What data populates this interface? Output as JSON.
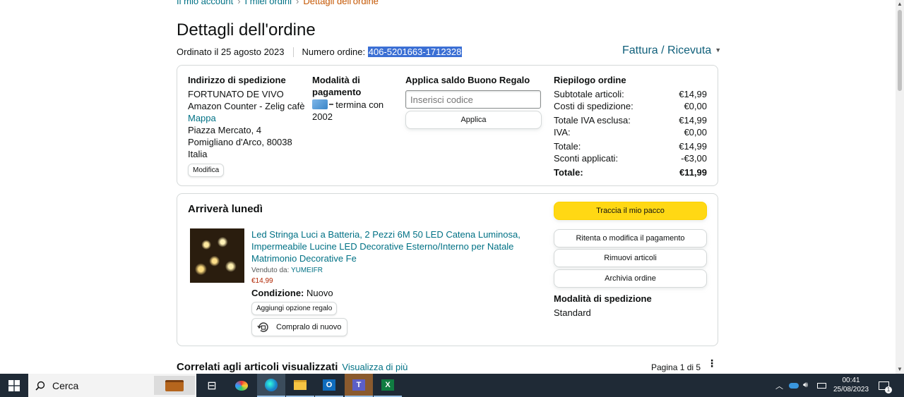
{
  "breadcrumb": {
    "items": [
      "Il mio account",
      "I miei ordini",
      "Dettagli dell'ordine"
    ],
    "separator": "›"
  },
  "title": "Dettagli dell'ordine",
  "order_meta": {
    "ordered_on": "Ordinato il 25 agosto 2023",
    "number_label": "Numero ordine:",
    "number": "406-5201663-1712328"
  },
  "invoice_link": "Fattura / Ricevuta",
  "shipping_address": {
    "heading": "Indirizzo di spedizione",
    "lines": [
      "FORTUNATO DE VIVO",
      "Amazon Counter - Zelig cafè"
    ],
    "map_link": "Mappa",
    "lines2": [
      "Piazza Mercato, 4",
      "Pomigliano d'Arco, 80038",
      "Italia"
    ],
    "edit_button": "Modifica"
  },
  "payment": {
    "heading_line1": "Modalità di",
    "heading_line2": "pagamento",
    "card_text": "termina con",
    "card_digits": "2002"
  },
  "gift": {
    "heading": "Applica saldo Buono Regalo",
    "placeholder": "Inserisci codice",
    "apply_button": "Applica"
  },
  "summary": {
    "heading": "Riepilogo ordine",
    "rows": [
      {
        "label": "Subtotale articoli:",
        "value": "€14,99"
      },
      {
        "label": "Costi di spedizione:",
        "value": "€0,00"
      },
      {
        "label": "Totale IVA esclusa:",
        "value": "€14,99"
      },
      {
        "label": "IVA:",
        "value": "€0,00"
      },
      {
        "label": "Totale:",
        "value": "€14,99"
      },
      {
        "label": "Sconti applicati:",
        "value": "-€3,00"
      }
    ],
    "total": {
      "label": "Totale:",
      "value": "€11,99"
    }
  },
  "shipment": {
    "heading": "Arriverà lunedì",
    "product": {
      "title": "Led Stringa Luci a Batteria, 2 Pezzi 6M 50 LED Catena Luminosa, Impermeabile Lucine LED Decorative Esterno/Interno per Natale Matrimonio Decorative Fe",
      "sold_by_label": "Venduto da:",
      "seller": "YUMEIFR",
      "price": "€14,99",
      "condition_label": "Condizione:",
      "condition": "Nuovo",
      "gift_button": "Aggiungi opzione regalo",
      "buy_again_button": "Compralo di nuovo"
    },
    "actions": {
      "track": "Traccia il mio pacco",
      "retry_payment": "Ritenta o modifica il pagamento",
      "remove": "Rimuovi articoli",
      "archive": "Archivia ordine"
    },
    "shipping_mode_heading": "Modalità di spedizione",
    "shipping_mode": "Standard"
  },
  "related": {
    "heading": "Correlati agli articoli visualizzati",
    "more_link": "Visualizza di più",
    "pagination": "Pagina 1 di 5"
  },
  "taskbar": {
    "search_label": "Cerca",
    "time": "00:41",
    "date": "25/08/2023",
    "notification_count": "1"
  },
  "colors": {
    "link": "#007185",
    "accent_orange": "#c45500",
    "track_button": "#ffd814",
    "selection": "#3b6fd4",
    "taskbar": "#1f2a36"
  }
}
